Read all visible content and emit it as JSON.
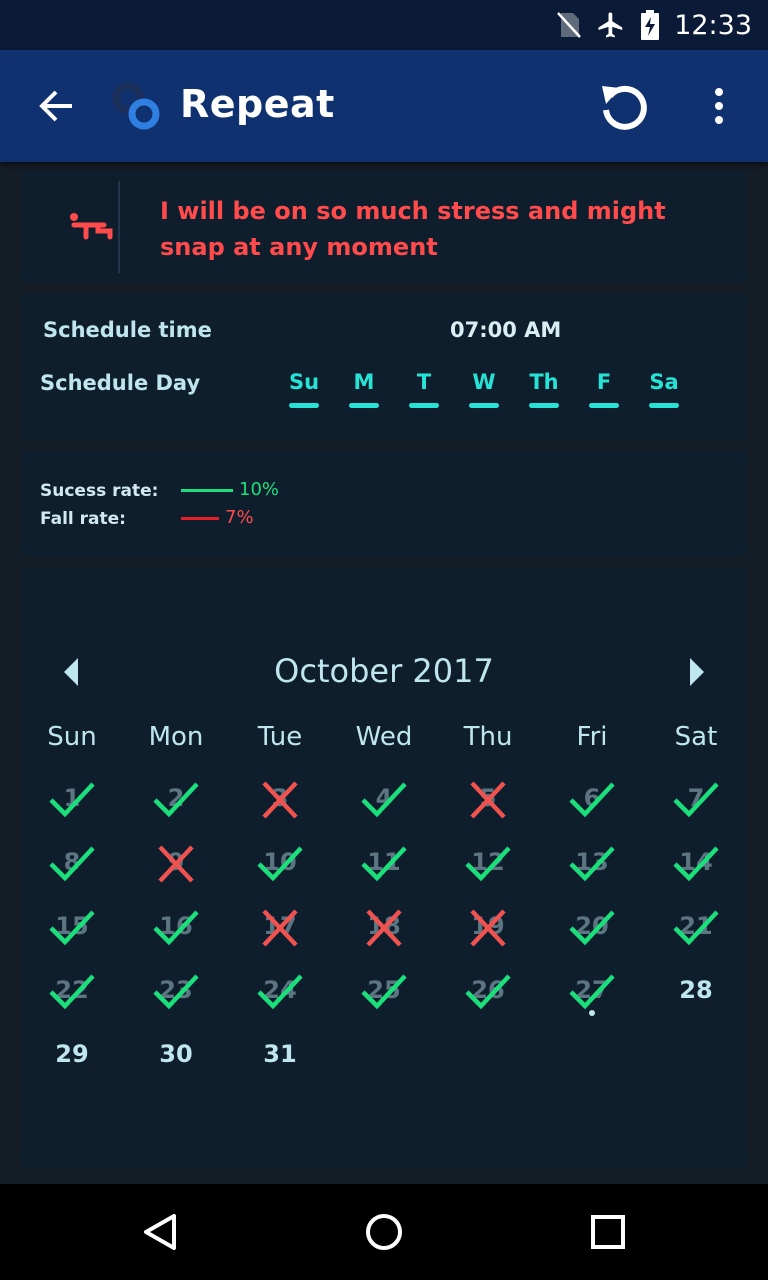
{
  "status_bar": {
    "time": "12:33"
  },
  "app_bar": {
    "title": "Repeat"
  },
  "habit": {
    "text": "I will be on so much stress and might snap at any moment"
  },
  "schedule": {
    "time_label": "Schedule time",
    "time_value": "07:00 AM",
    "day_label": "Schedule Day",
    "days": [
      "Su",
      "M",
      "T",
      "W",
      "Th",
      "F",
      "Sa"
    ]
  },
  "rates": {
    "success_label": "Sucess rate:",
    "success_value": "10%",
    "success_color": "#19e07a",
    "fail_label": "Fall rate:",
    "fail_value": "7%",
    "fail_color": "#e8202a"
  },
  "calendar": {
    "month_title": "October 2017",
    "weekdays": [
      "Sun",
      "Mon",
      "Tue",
      "Wed",
      "Thu",
      "Fri",
      "Sat"
    ],
    "first_weekday": 0,
    "days_in_month": 31,
    "today": 27,
    "marks": {
      "1": "check",
      "2": "check",
      "3": "cross",
      "4": "check",
      "5": "cross",
      "6": "check",
      "7": "check",
      "8": "check",
      "9": "cross",
      "10": "check",
      "11": "check",
      "12": "check",
      "13": "check",
      "14": "check",
      "15": "check",
      "16": "check",
      "17": "cross",
      "18": "cross",
      "19": "cross",
      "20": "check",
      "21": "check",
      "22": "check",
      "23": "check",
      "24": "check",
      "25": "check",
      "26": "check",
      "27": "check"
    },
    "check_color": "#19e07a",
    "cross_color": "#f0524f"
  }
}
